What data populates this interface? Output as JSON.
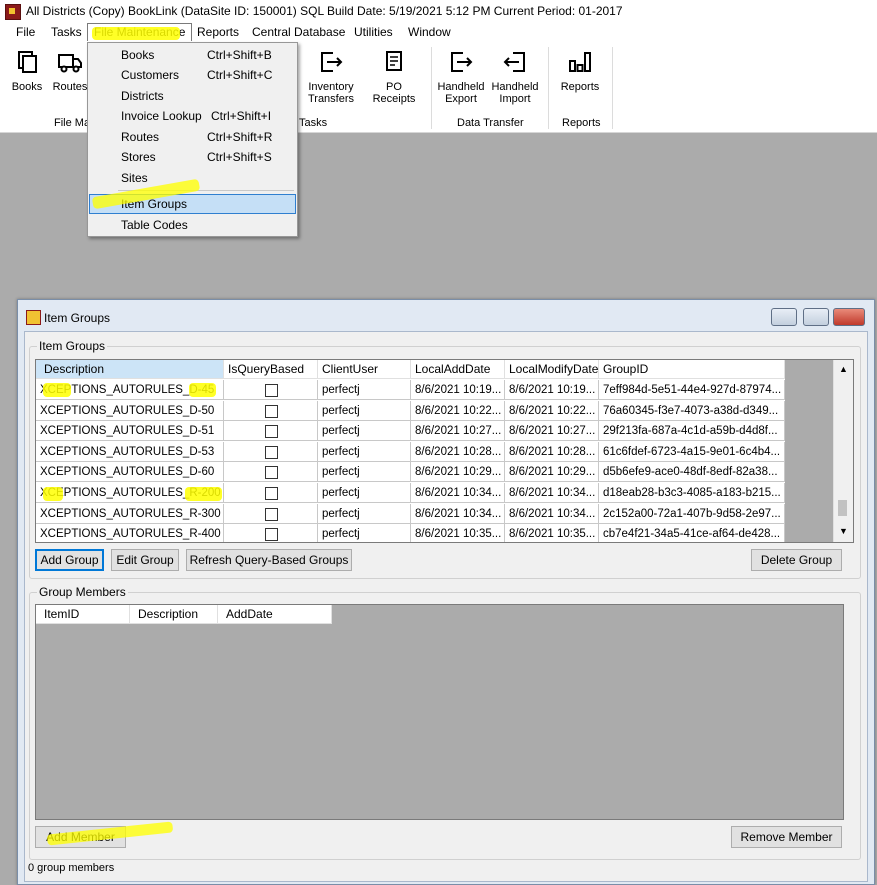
{
  "window": {
    "title": "All Districts (Copy) BookLink (DataSite ID: 150001) SQL   Build Date: 5/19/2021 5:12 PM   Current Period: 01-2017"
  },
  "menubar": [
    {
      "label": "File"
    },
    {
      "label": "Tasks"
    },
    {
      "label": "File Maintenance"
    },
    {
      "label": "Reports"
    },
    {
      "label": "Central Database"
    },
    {
      "label": "Utilities"
    },
    {
      "label": "Window"
    }
  ],
  "ribbon": {
    "buttons": [
      {
        "label": "Books",
        "icon": "books-icon"
      },
      {
        "label": "Routes",
        "icon": "truck-icon"
      },
      {
        "label": "Inventory\nTransfers",
        "icon": "transfer-icon"
      },
      {
        "label": "PO Receipts",
        "icon": "receipt-icon"
      },
      {
        "label": "Handheld\nExport",
        "icon": "export-icon"
      },
      {
        "label": "Handheld\nImport",
        "icon": "import-icon"
      },
      {
        "label": "Reports",
        "icon": "bar-chart-icon"
      }
    ],
    "groups": [
      "File Ma",
      "Tasks",
      "Data Transfer",
      "Reports"
    ]
  },
  "dropdown": {
    "items": [
      {
        "label": "Books",
        "shortcut": "Ctrl+Shift+B"
      },
      {
        "label": "Customers",
        "shortcut": "Ctrl+Shift+C"
      },
      {
        "label": "Districts",
        "shortcut": ""
      },
      {
        "label": "Invoice Lookup",
        "shortcut": "Ctrl+Shift+I"
      },
      {
        "label": "Routes",
        "shortcut": "Ctrl+Shift+R"
      },
      {
        "label": "Stores",
        "shortcut": "Ctrl+Shift+S"
      },
      {
        "label": "Sites",
        "shortcut": ""
      }
    ],
    "items2": [
      {
        "label": "Item Groups",
        "selected": true
      },
      {
        "label": "Table Codes",
        "selected": false
      }
    ]
  },
  "item_groups_window": {
    "title": "Item Groups",
    "groups_label": "Item Groups",
    "columns": [
      "Description",
      "IsQueryBased",
      "ClientUser",
      "LocalAddDate",
      "LocalModifyDate",
      "GroupID"
    ],
    "rows": [
      {
        "desc": "XCEPTIONS_AUTORULES_D-45",
        "query": false,
        "user": "perfectj",
        "add": "8/6/2021 10:19...",
        "mod": "8/6/2021 10:19...",
        "gid": "7eff984d-5e51-44e4-927d-87974..."
      },
      {
        "desc": "XCEPTIONS_AUTORULES_D-50",
        "query": false,
        "user": "perfectj",
        "add": "8/6/2021 10:22...",
        "mod": "8/6/2021 10:22...",
        "gid": "76a60345-f3e7-4073-a38d-d349..."
      },
      {
        "desc": "XCEPTIONS_AUTORULES_D-51",
        "query": false,
        "user": "perfectj",
        "add": "8/6/2021 10:27...",
        "mod": "8/6/2021 10:27...",
        "gid": "29f213fa-687a-4c1d-a59b-d4d8f..."
      },
      {
        "desc": "XCEPTIONS_AUTORULES_D-53",
        "query": false,
        "user": "perfectj",
        "add": "8/6/2021 10:28...",
        "mod": "8/6/2021 10:28...",
        "gid": "61c6fdef-6723-4a15-9e01-6c4b4..."
      },
      {
        "desc": "XCEPTIONS_AUTORULES_D-60",
        "query": false,
        "user": "perfectj",
        "add": "8/6/2021 10:29...",
        "mod": "8/6/2021 10:29...",
        "gid": "d5b6efe9-ace0-48df-8edf-82a38..."
      },
      {
        "desc": "XCEPTIONS_AUTORULES_R-200",
        "query": false,
        "user": "perfectj",
        "add": "8/6/2021 10:34...",
        "mod": "8/6/2021 10:34...",
        "gid": "d18eab28-b3c3-4085-a183-b215..."
      },
      {
        "desc": "XCEPTIONS_AUTORULES_R-300",
        "query": false,
        "user": "perfectj",
        "add": "8/6/2021 10:34...",
        "mod": "8/6/2021 10:34...",
        "gid": "2c152a00-72a1-407b-9d58-2e97..."
      },
      {
        "desc": "XCEPTIONS_AUTORULES_R-400",
        "query": false,
        "user": "perfectj",
        "add": "8/6/2021 10:35...",
        "mod": "8/6/2021 10:35...",
        "gid": "cb7e4f21-34a5-41ce-af64-de428..."
      }
    ],
    "buttons": {
      "add_group": "Add Group",
      "edit_group": "Edit Group",
      "refresh": "Refresh Query-Based Groups",
      "delete_group": "Delete Group"
    },
    "members_label": "Group Members",
    "member_columns": [
      "ItemID",
      "Description",
      "AddDate"
    ],
    "add_member": "Add Member",
    "remove_member": "Remove Member",
    "status": "0 group members"
  },
  "colors": {
    "highlight": "#ffff00",
    "selected_menu": "#c5dff6",
    "workspace": "#ababab"
  }
}
